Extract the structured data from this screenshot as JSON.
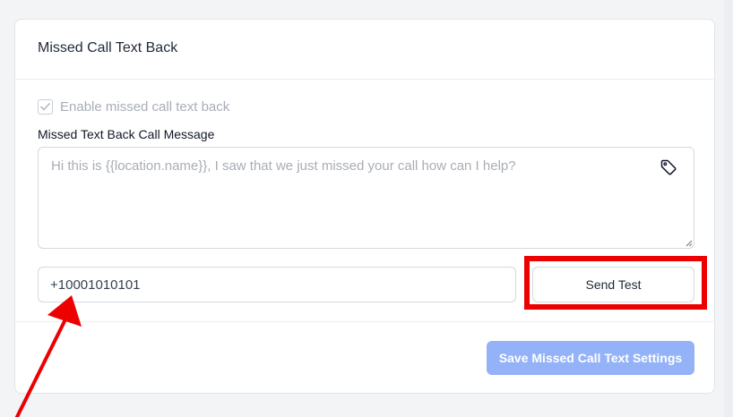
{
  "card": {
    "title": "Missed Call Text Back"
  },
  "enable_checkbox": {
    "label": "Enable missed call text back",
    "checked": true
  },
  "message": {
    "label": "Missed Text Back Call Message",
    "placeholder": "Hi this is {{location.name}}, I saw that we just missed your call how can I help?"
  },
  "phone": {
    "value": "+10001010101"
  },
  "send_test": {
    "label": "Send Test"
  },
  "save": {
    "label": "Save Missed Call Text Settings"
  },
  "icons": {
    "tag": "tag-icon",
    "check": "check-icon"
  },
  "colors": {
    "primary_disabled": "#93b2f8",
    "annotation_red": "#ec0000"
  }
}
